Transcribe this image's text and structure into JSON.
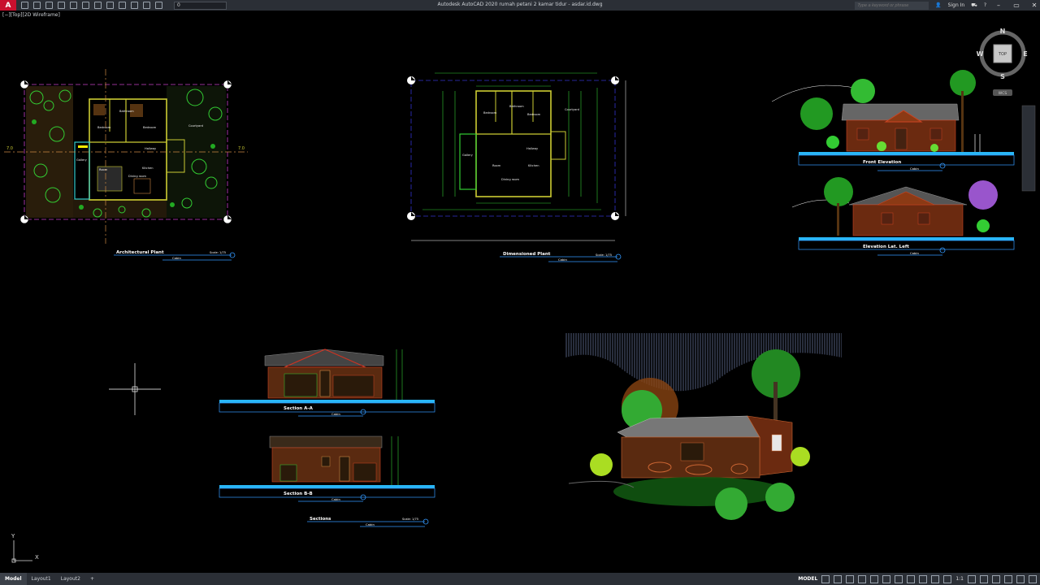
{
  "app": {
    "logo": "A",
    "title": "Autodesk AutoCAD 2020   rumah petani 2 kamar tidur - asdar.id.dwg",
    "layer": "0",
    "search_placeholder": "Type a keyword or phrase",
    "sign_in": "Sign In",
    "viewport_label": "[−][Top][2D Wireframe]"
  },
  "viewcube": {
    "n": "N",
    "s": "S",
    "e": "E",
    "w": "W",
    "top": "TOP",
    "wcs": "WCS"
  },
  "drawings": {
    "arch_plan": {
      "title": "Architectural Plant",
      "sub": "Cabin",
      "scale": "Scale: 1/75",
      "rooms": [
        "Bedroom",
        "Bathroom",
        "Bedroom",
        "Courtyard",
        "Gallery",
        "Hallway",
        "Room",
        "Dining room",
        "Kitchen"
      ],
      "axis_left": "7.0",
      "axis_right": "7.0"
    },
    "dim_plan": {
      "title": "Dimensioned Plant",
      "sub": "Cabin",
      "scale": "Scale: 1/75",
      "rooms": [
        "Bedroom",
        "Bathroom",
        "Bedroom",
        "Courtyard",
        "Gallery",
        "Hallway",
        "Room",
        "Dining room",
        "Kitchen"
      ]
    },
    "front_elev": {
      "title": "Front Elevation",
      "sub": "Cabin"
    },
    "lat_elev": {
      "title": "Elevation Lat. Left",
      "sub": "Cabin"
    },
    "section_aa": {
      "title": "Section A-A",
      "sub": "Cabin"
    },
    "section_bb": {
      "title": "Section B-B",
      "sub": "Cabin"
    },
    "sections": {
      "title": "Sections",
      "sub": "Cabin",
      "scale": "Scale: 1/75"
    }
  },
  "ucs": {
    "x": "X",
    "y": "Y"
  },
  "status": {
    "tabs": [
      "Model",
      "Layout1",
      "Layout2"
    ],
    "add": "+",
    "model_label": "MODEL",
    "scale": "1:1"
  }
}
